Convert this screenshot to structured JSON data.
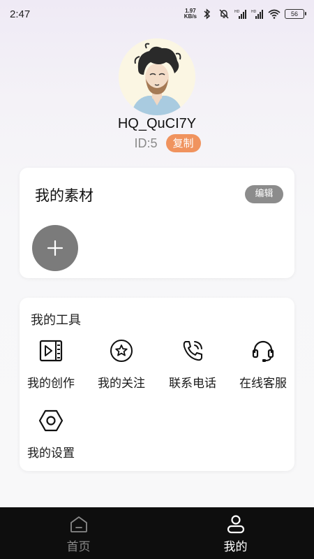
{
  "status_bar": {
    "time": "2:47",
    "speed_value": "1.97",
    "speed_unit": "KB/s",
    "battery": "56",
    "icons": [
      "bluetooth-icon",
      "mute-bell-icon",
      "hd-signal-icon",
      "hd-signal-icon",
      "wifi-icon",
      "battery-icon"
    ]
  },
  "profile": {
    "username": "HQ_QuCI7Y",
    "id_text": "ID:5",
    "copy_label": "复制"
  },
  "materials": {
    "title": "我的素材",
    "edit_label": "编辑",
    "add_icon": "plus-icon"
  },
  "tools": {
    "title": "我的工具",
    "items": [
      {
        "label": "我的创作",
        "icon": "video-play-icon"
      },
      {
        "label": "我的关注",
        "icon": "star-circle-icon"
      },
      {
        "label": "联系电话",
        "icon": "phone-icon"
      },
      {
        "label": "在线客服",
        "icon": "headset-icon"
      },
      {
        "label": "我的设置",
        "icon": "hexagon-settings-icon"
      }
    ]
  },
  "bottom_nav": {
    "items": [
      {
        "label": "首页",
        "icon": "home-icon",
        "active": false
      },
      {
        "label": "我的",
        "icon": "user-icon",
        "active": true
      }
    ]
  },
  "colors": {
    "accent": "#f0935e",
    "nav_bg": "#0e0e0e",
    "edit_bg": "#8c8c8c",
    "add_bg": "#7b7b7b"
  }
}
